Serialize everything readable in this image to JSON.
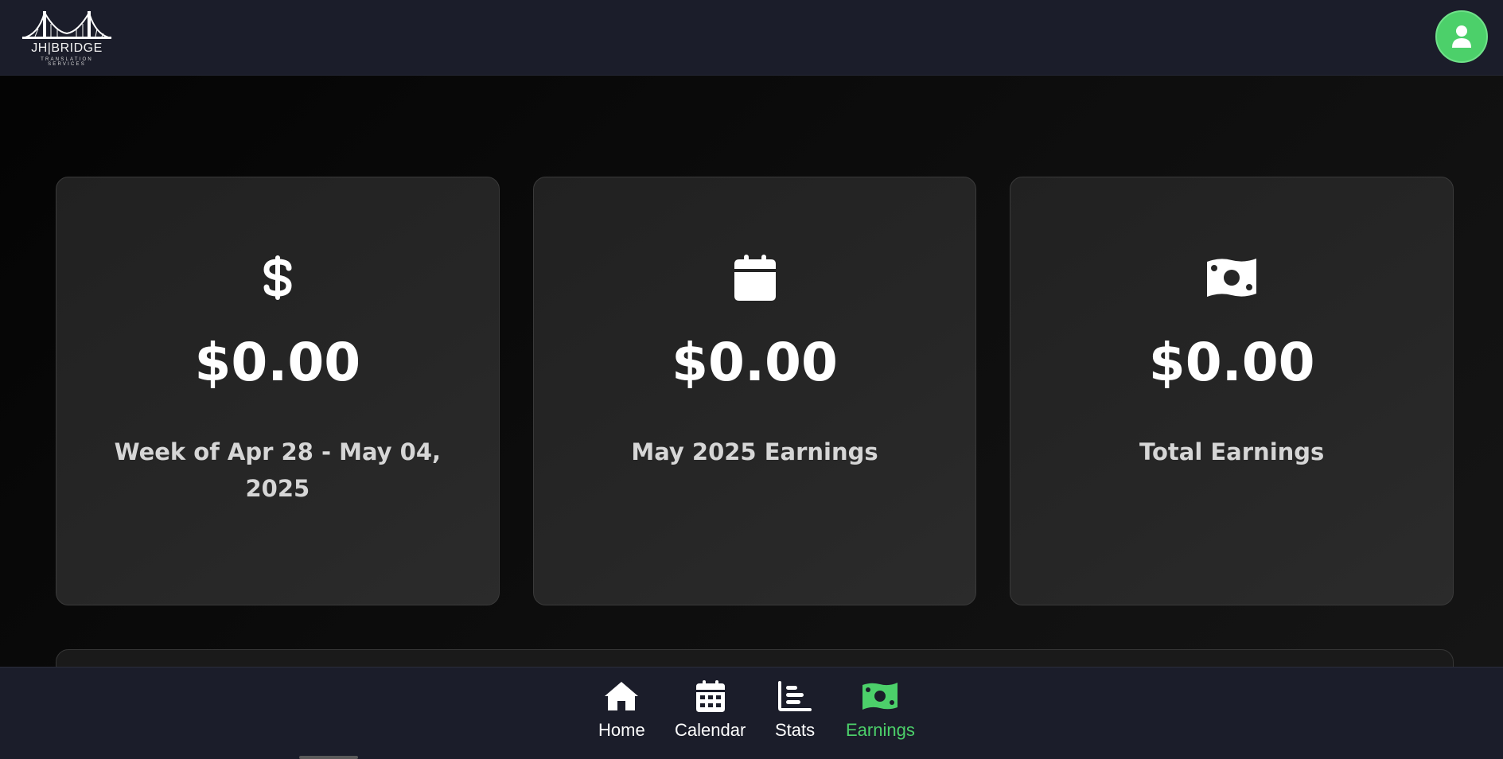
{
  "header": {
    "logo": {
      "title": "JH|BRIDGE",
      "subtitle": "TRANSLATION SERVICES",
      "icon": "bridge-icon"
    },
    "profile": {
      "icon": "user-icon",
      "color": "#4cd06a"
    }
  },
  "cards": [
    {
      "icon": "dollar-sign-icon",
      "value": "$0.00",
      "label": "Week of Apr 28 - May 04, 2025"
    },
    {
      "icon": "calendar-icon",
      "value": "$0.00",
      "label": "May 2025 Earnings"
    },
    {
      "icon": "money-bill-icon",
      "value": "$0.00",
      "label": "Total Earnings"
    }
  ],
  "nav": {
    "items": [
      {
        "label": "Home",
        "icon": "home-icon",
        "active": false
      },
      {
        "label": "Calendar",
        "icon": "calendar-icon",
        "active": false
      },
      {
        "label": "Stats",
        "icon": "chart-icon",
        "active": false
      },
      {
        "label": "Earnings",
        "icon": "money-bill-icon",
        "active": true
      }
    ],
    "active_color": "#4cd06a"
  }
}
